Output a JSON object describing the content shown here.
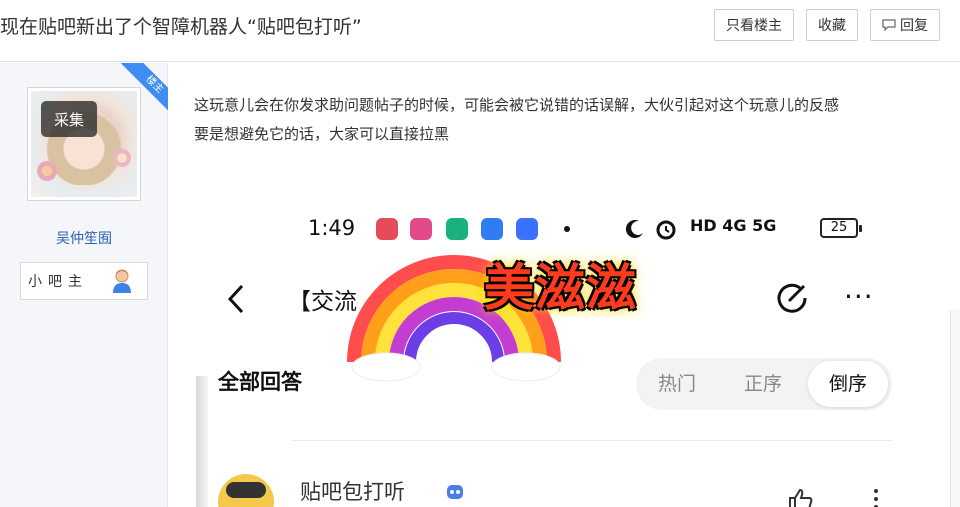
{
  "thread": {
    "title": "现在贴吧新出了个智障机器人“贴吧包打听”"
  },
  "actions": {
    "only_op": "只看楼主",
    "favorite": "收藏",
    "reply": "回复"
  },
  "author": {
    "avatar_badge": "采集",
    "op_ribbon": "楼主",
    "name": "吴仲笙囿",
    "role": "小吧主",
    "role_icon": "user-icon"
  },
  "post": {
    "paragraphs": [
      "这玩意儿会在你发求助问题帖子的时候，可能会被它说错的话误解，大伙引起对这个玩意儿的反感",
      "要是想避免它的话，大家可以直接拉黑"
    ]
  },
  "screenshot": {
    "status": {
      "time": "1:49",
      "network": "HD 4G 5G",
      "battery": "25",
      "app_icon_colors": [
        "#e64b5a",
        "#e44a8a",
        "#19b27e",
        "#2d7cf0",
        "#3a72ff"
      ]
    },
    "nav": {
      "title": "【交流",
      "back_icon": "chevron-left-icon",
      "edit_icon": "share-edit-icon",
      "more_label": "···"
    },
    "sticker": {
      "text": "美滋滋"
    },
    "answers": {
      "header": "全部回答",
      "sort_tabs": [
        "热门",
        "正序",
        "倒序"
      ],
      "active_sort": "倒序"
    },
    "reply": {
      "user": "贴吧包打听"
    }
  },
  "colors": {
    "link_blue": "#2d64b3",
    "ribbon_blue": "#3f8cf2",
    "sidebar_bg": "#f4f6f9"
  }
}
